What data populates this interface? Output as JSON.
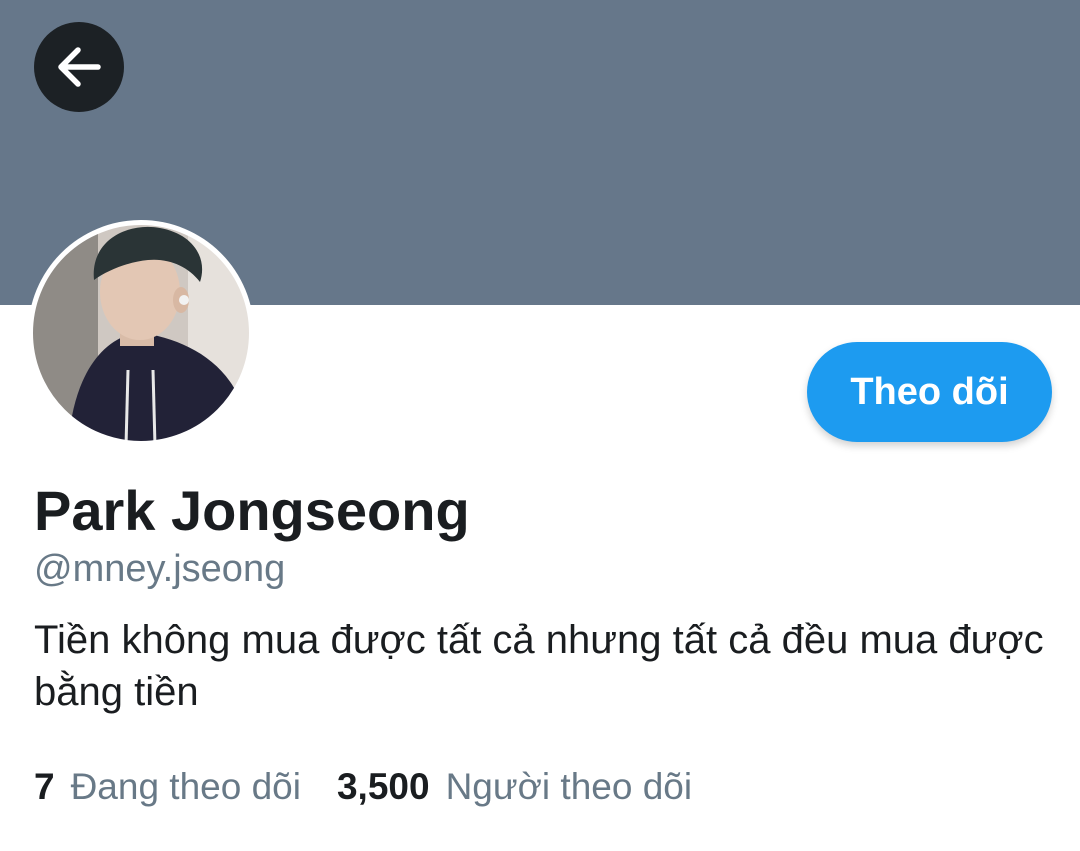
{
  "header": {
    "back_icon": "arrow-left-icon",
    "banner_color": "#66778a"
  },
  "profile": {
    "avatar_alt": "profile photo",
    "display_name": "Park Jongseong",
    "handle": "@mney.jseong",
    "bio": "Tiền không mua được tất cả nhưng tất cả đều mua được bằng tiền",
    "follow_button_label": "Theo dõi",
    "accent_color": "#1d9bf0"
  },
  "stats": [
    {
      "count": "7",
      "label": "Đang theo dõi"
    },
    {
      "count": "3,500",
      "label": "Người theo dõi"
    }
  ]
}
